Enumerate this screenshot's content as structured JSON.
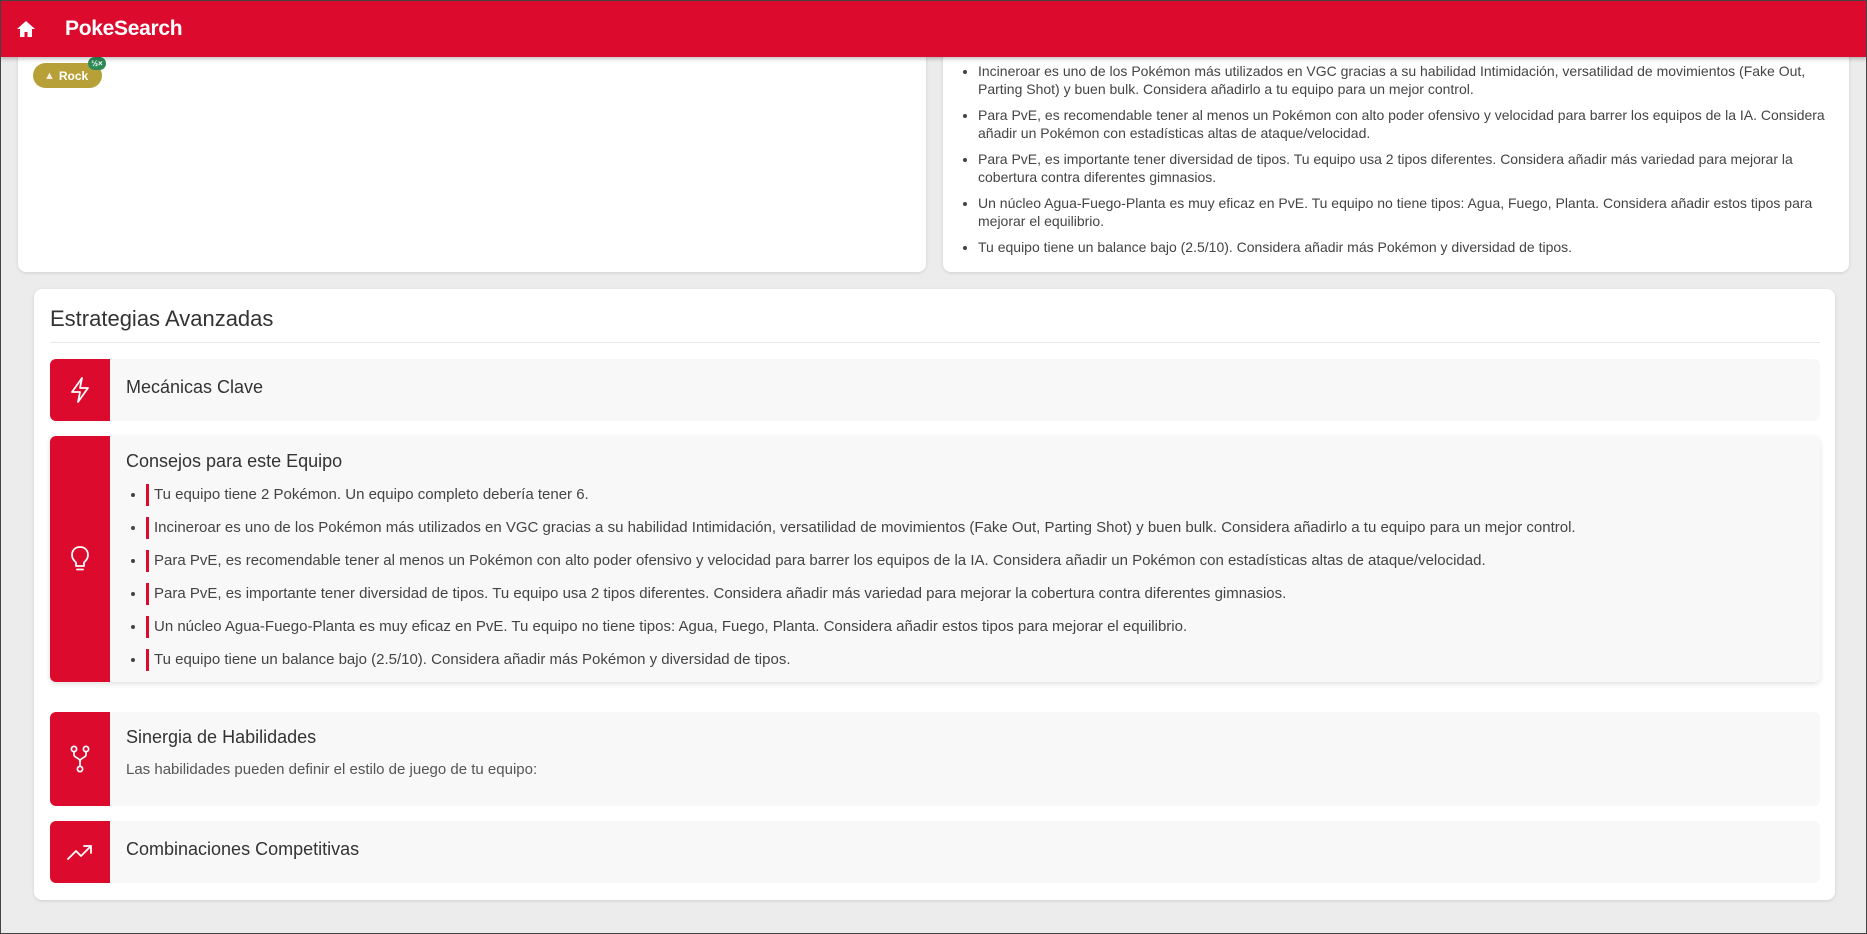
{
  "app": {
    "title": "PokeSearch",
    "accent_color": "#dc0a2d"
  },
  "type_badge": {
    "label": "Rock",
    "multiplier": "½×",
    "color": "#b8a038"
  },
  "right_card": {
    "items": [
      "Incineroar es uno de los Pokémon más utilizados en VGC gracias a su habilidad Intimidación, versatilidad de movimientos (Fake Out, Parting Shot) y buen bulk. Considera añadirlo a tu equipo para un mejor control.",
      "Para PvE, es recomendable tener al menos un Pokémon con alto poder ofensivo y velocidad para barrer los equipos de la IA. Considera añadir un Pokémon con estadísticas altas de ataque/velocidad.",
      "Para PvE, es importante tener diversidad de tipos. Tu equipo usa 2 tipos diferentes. Considera añadir más variedad para mejorar la cobertura contra diferentes gimnasios.",
      "Un núcleo Agua-Fuego-Planta es muy eficaz en PvE. Tu equipo no tiene tipos: Agua, Fuego, Planta. Considera añadir estos tipos para mejorar el equilibrio.",
      "Tu equipo tiene un balance bajo (2.5/10). Considera añadir más Pokémon y diversidad de tipos."
    ]
  },
  "advanced": {
    "title": "Estrategias Avanzadas",
    "sections": [
      {
        "title": "Mecánicas Clave",
        "icon": "lightning-icon"
      },
      {
        "title": "Consejos para este Equipo",
        "icon": "lightbulb-icon",
        "tips": [
          "Tu equipo tiene 2 Pokémon. Un equipo completo debería tener 6.",
          "Incineroar es uno de los Pokémon más utilizados en VGC gracias a su habilidad Intimidación, versatilidad de movimientos (Fake Out, Parting Shot) y buen bulk. Considera añadirlo a tu equipo para un mejor control.",
          "Para PvE, es recomendable tener al menos un Pokémon con alto poder ofensivo y velocidad para barrer los equipos de la IA. Considera añadir un Pokémon con estadísticas altas de ataque/velocidad.",
          "Para PvE, es importante tener diversidad de tipos. Tu equipo usa 2 tipos diferentes. Considera añadir más variedad para mejorar la cobertura contra diferentes gimnasios.",
          "Un núcleo Agua-Fuego-Planta es muy eficaz en PvE. Tu equipo no tiene tipos: Agua, Fuego, Planta. Considera añadir estos tipos para mejorar el equilibrio.",
          "Tu equipo tiene un balance bajo (2.5/10). Considera añadir más Pokémon y diversidad de tipos."
        ]
      },
      {
        "title": "Sinergia de Habilidades",
        "icon": "git-fork-icon",
        "description": "Las habilidades pueden definir el estilo de juego de tu equipo:"
      },
      {
        "title": "Combinaciones Competitivas",
        "icon": "trending-up-icon"
      }
    ]
  }
}
